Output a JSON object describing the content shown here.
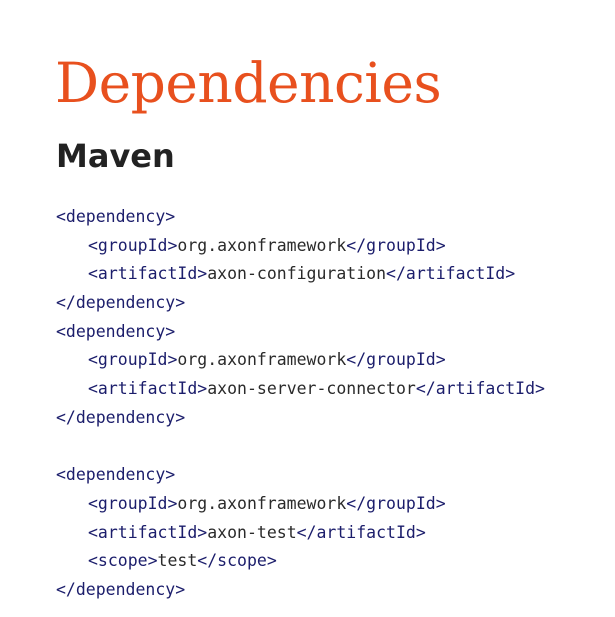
{
  "heading": {
    "title": "Dependencies",
    "subtitle": "Maven"
  },
  "colors": {
    "title": "#e8501e",
    "subtitle": "#222222",
    "tag": "#1b1d6b",
    "text": "#2a2a2a"
  },
  "code_lines": [
    {
      "indent": false,
      "open": "<dependency>",
      "text": "",
      "close": ""
    },
    {
      "indent": true,
      "open": "<groupId>",
      "text": "org.axonframework",
      "close": "</groupId>"
    },
    {
      "indent": true,
      "open": "<artifactId>",
      "text": "axon-configuration",
      "close": "</artifactId>"
    },
    {
      "indent": false,
      "open": "</dependency>",
      "text": "",
      "close": ""
    },
    {
      "indent": false,
      "open": "<dependency>",
      "text": "",
      "close": ""
    },
    {
      "indent": true,
      "open": "<groupId>",
      "text": "org.axonframework",
      "close": "</groupId>"
    },
    {
      "indent": true,
      "open": "<artifactId>",
      "text": "axon-server-connector",
      "close": "</artifactId>"
    },
    {
      "indent": false,
      "open": "</dependency>",
      "text": "",
      "close": ""
    },
    {
      "indent": false,
      "open": "",
      "text": "",
      "close": ""
    },
    {
      "indent": false,
      "open": "<dependency>",
      "text": "",
      "close": ""
    },
    {
      "indent": true,
      "open": "<groupId>",
      "text": "org.axonframework",
      "close": "</groupId>"
    },
    {
      "indent": true,
      "open": "<artifactId>",
      "text": "axon-test",
      "close": "</artifactId>"
    },
    {
      "indent": true,
      "open": "<scope>",
      "text": "test",
      "close": "</scope>"
    },
    {
      "indent": false,
      "open": "</dependency>",
      "text": "",
      "close": ""
    }
  ]
}
